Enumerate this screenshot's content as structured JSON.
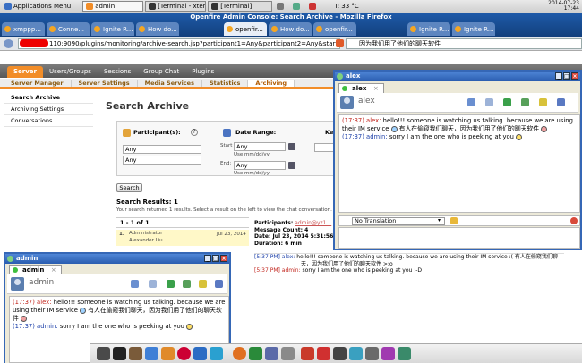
{
  "system_panel": {
    "menu_label": "Applications Menu",
    "tasks": [
      "xmppp...",
      "Conne...",
      "How do...",
      "Ignite R...",
      "Ignite R...",
      "How do...",
      "openfir...",
      "openfir...",
      "Ignite R...",
      "Firefox..."
    ],
    "window_tabs": [
      "admin",
      "[Terminal - xter...",
      "[Terminal]"
    ],
    "temperature": "T: 33 °C",
    "date": "2014-07-23",
    "time": "17:44"
  },
  "browser": {
    "title": "Openfire Admin Console: Search Archive - Mozilla Firefox",
    "url": "110:9090/plugins/monitoring/archive-search.jsp?participant1=Any&participant2=Any&start",
    "search_text": "因为我们用了他们的聊天软件"
  },
  "openfire": {
    "nav_tabs": [
      "Server",
      "Users/Groups",
      "Sessions",
      "Group Chat",
      "Plugins"
    ],
    "sub_tabs": [
      "Server Manager",
      "Server Settings",
      "Media Services",
      "Statistics",
      "Archiving"
    ],
    "sidebar": [
      "Search Archive",
      "Archiving Settings",
      "Conversations"
    ],
    "page_title": "Search Archive",
    "participants_label": "Participant(s):",
    "participant1": "Any",
    "participant2": "Any",
    "date_range_label": "Date Range:",
    "start_label": "Start",
    "start_value": "Any",
    "end_label": "End:",
    "end_value": "Any",
    "date_hint": "Use mm/dd/yy",
    "keyword_label": "Ke",
    "search_button": "Search",
    "results_title": "Search Results: 1",
    "results_sub": "Your search returned 1 results. Select a result on the left to view the chat conversation.",
    "results_range": "1 - 1 of 1",
    "result": {
      "num": "1.",
      "user1": "Administrator",
      "user2": "Alexander Liu",
      "date": "Jul 23, 2014"
    },
    "detail": {
      "participants_label": "Participants:",
      "participants_value": "admin@yz1...",
      "message_count": "Message Count: 4",
      "date": "Date: Jul 23, 2014 5:31:56 P",
      "duration": "Duration: 6 min",
      "line1_time": "[5:37 PM] alex:",
      "line1_text": "hello!!! someone is watching us talking. because we are using their IM service :(  有人在偷窥我们聊天，因为我们用了他们的聊天软件 >:o",
      "line2_time": "[5:37 PM] admin:",
      "line2_text": "sorry I am the one who is peeking at you :-D"
    }
  },
  "alex_window": {
    "title": "alex",
    "tab": "alex",
    "contact_name": "alex",
    "msg1_prefix": "(17:37) alex:",
    "msg1_text": "hello!!! someone is watching us talking. because we are using their IM service",
    "msg1_cn": "有人在偷窥我们聊天，因为我们用了他们的聊天软件",
    "msg2_prefix": "(17:37) admin:",
    "msg2_text": "sorry I am the one who is peeking at you",
    "translation": "No Translation"
  },
  "admin_window": {
    "title": "admin",
    "tab": "admin",
    "contact_name": "admin",
    "msg1_prefix": "(17:37) alex:",
    "msg1_text": "hello!!! someone is watching us talking. because we are using their IM service",
    "msg1_cn": "有人在偷窥我们聊天，因为我们用了他们的聊天软件",
    "msg2_prefix": "(17:37) admin:",
    "msg2_text": "sorry I am the one who is peeking at you"
  },
  "colors": {
    "accent": "#f28d28",
    "window_border": "#3567b6",
    "me": "#c2261e",
    "them": "#1c3fa8"
  }
}
